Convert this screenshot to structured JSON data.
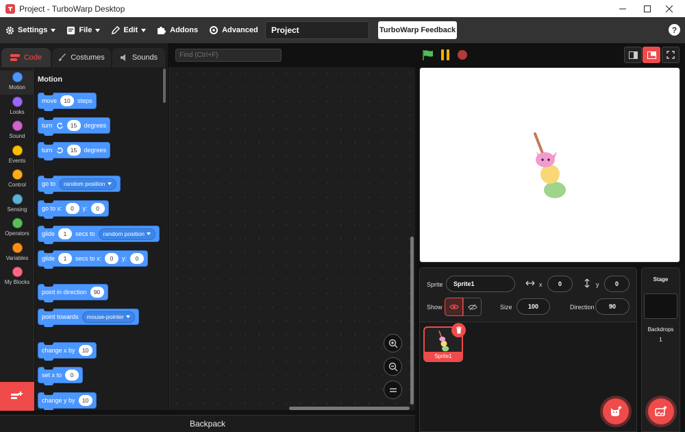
{
  "window": {
    "title": "Project - TurboWarp Desktop"
  },
  "menu": {
    "settings": "Settings",
    "file": "File",
    "edit": "Edit",
    "addons": "Addons",
    "advanced": "Advanced",
    "project_title": "Project",
    "feedback": "TurboWarp Feedback",
    "help": "?"
  },
  "tabs": {
    "code": "Code",
    "costumes": "Costumes",
    "sounds": "Sounds",
    "active": "Code"
  },
  "categories": [
    {
      "label": "Motion",
      "color": "#4c97ff"
    },
    {
      "label": "Looks",
      "color": "#9966ff"
    },
    {
      "label": "Sound",
      "color": "#cf63cf"
    },
    {
      "label": "Events",
      "color": "#ffbf00"
    },
    {
      "label": "Control",
      "color": "#ffab19"
    },
    {
      "label": "Sensing",
      "color": "#5cb1d6"
    },
    {
      "label": "Operators",
      "color": "#59c059"
    },
    {
      "label": "Variables",
      "color": "#ff8c1a"
    },
    {
      "label": "My Blocks",
      "color": "#ff6680"
    }
  ],
  "palette": {
    "heading": "Motion",
    "blocks": {
      "move": {
        "a": "move",
        "v": "10",
        "b": "steps"
      },
      "turn_cw": {
        "a": "turn",
        "v": "15",
        "b": "degrees"
      },
      "turn_ccw": {
        "a": "turn",
        "v": "15",
        "b": "degrees"
      },
      "goto": {
        "a": "go to",
        "dd": "random position"
      },
      "gotoxy": {
        "a": "go to x:",
        "x": "0",
        "b": "y:",
        "y": "0"
      },
      "glide_to": {
        "a": "glide",
        "v": "1",
        "b": "secs to",
        "dd": "random position"
      },
      "glide_xy": {
        "a": "glide",
        "v": "1",
        "b": "secs to x:",
        "x": "0",
        "c": "y:",
        "y": "0"
      },
      "point_dir": {
        "a": "point in direction",
        "v": "90"
      },
      "point_towards": {
        "a": "point towards",
        "dd": "mouse-pointer"
      },
      "change_x": {
        "a": "change x by",
        "v": "10"
      },
      "set_x": {
        "a": "set x to",
        "v": "0"
      },
      "change_y": {
        "a": "change y by",
        "v": "10"
      }
    }
  },
  "workspace": {
    "find_placeholder": "Find (Ctrl+F)"
  },
  "backpack": "Backpack",
  "sprite_info": {
    "sprite_label": "Sprite",
    "sprite_name": "Sprite1",
    "x_label": "x",
    "x": "0",
    "y_label": "y",
    "y": "0",
    "show_label": "Show",
    "size_label": "Size",
    "size": "100",
    "direction_label": "Direction",
    "direction": "90"
  },
  "sprites": [
    {
      "name": "Sprite1",
      "selected": true
    }
  ],
  "stage_pane": {
    "title": "Stage",
    "backdrops_label": "Backdrops",
    "backdrops_count": "1"
  },
  "colors": {
    "accent": "#ef4b4b",
    "motion": "#4c97ff",
    "green_flag": "#4cbf56",
    "pause": "#ffae00"
  }
}
